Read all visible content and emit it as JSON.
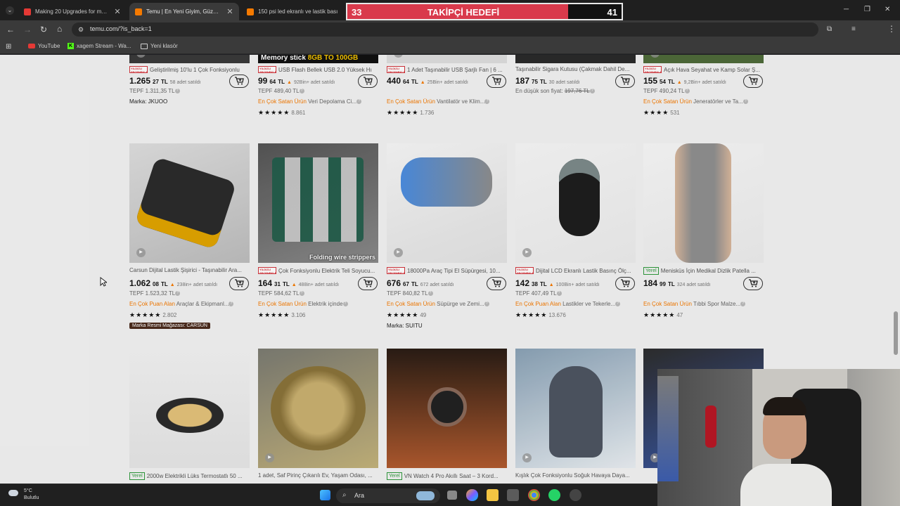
{
  "tabs": [
    {
      "title": "Making 20 Upgrades for my De",
      "favicon_color": "#e53935",
      "active": false
    },
    {
      "title": "Temu | En Yeni Giyim, Güzellik, E",
      "favicon_color": "#f57a00",
      "active": true
    },
    {
      "title": "150 psi led ekranlı ve lastik bası",
      "favicon_color": "#f57a00",
      "active": false
    }
  ],
  "address_bar": {
    "url": "temu.com/?is_back=1"
  },
  "bookmarks": [
    {
      "label": "YouTube",
      "icon": "youtube-icon"
    },
    {
      "label": "xagem Stream - Wa...",
      "icon": "kick-icon"
    },
    {
      "label": "Yeni klasör",
      "icon": "folder-icon"
    }
  ],
  "overlay": {
    "left": "33",
    "center": "TAKİPÇİ HEDEFİ",
    "right": "41",
    "progress": 0.805
  },
  "top_row": [
    {
      "badge": "yildizli",
      "title": "Geliştirilmiş 10'lu 1 Çok Fonksiyonlu",
      "price_main": "1.265",
      "price_dec": "27",
      "currency": "TL",
      "fire": false,
      "sold": "58 adet satıldı",
      "line2": "TEPF 1.311,35 TL",
      "line3_org": "",
      "line3_rest": "",
      "strike": "",
      "stars": "",
      "review_count": "",
      "brand": "Marka: JKUOO",
      "official": ""
    },
    {
      "badge": "yildizli",
      "title": "USB Flash Bellek USB 2.0 Yüksek Hı",
      "price_main": "99",
      "price_dec": "64",
      "currency": "TL",
      "fire": true,
      "sold": "92Bin+ adet satıldı",
      "line2": "TEPF 489,40 TL",
      "line3_org": "En Çok Satan Ürün",
      "line3_rest": " Veri Depolama Ci...",
      "strike": "",
      "stars": "★★★★★",
      "review_count": "8.861",
      "brand": "",
      "official": ""
    },
    {
      "badge": "yildizli",
      "title": "1 Adet Taşınabilir USB Şarjlı Fan | 6 ...",
      "price_main": "440",
      "price_dec": "64",
      "currency": "TL",
      "fire": true,
      "sold": "25Bin+ adet satıldı",
      "line2": "",
      "line3_org": "En Çok Satan Ürün",
      "line3_rest": " Vantilatör ve Klim...",
      "strike": "",
      "stars": "★★★★★",
      "review_count": "1.736",
      "brand": "",
      "official": ""
    },
    {
      "badge": "",
      "title": "Taşınabilir Sigara Kutusu (Çakmak Dahil De...",
      "price_main": "187",
      "price_dec": "75",
      "currency": "TL",
      "fire": false,
      "sold": "30 adet satıldı",
      "line2": "En düşük son fiyat: ",
      "strike": "197,76 TL",
      "line3_org": "",
      "line3_rest": "",
      "stars": "",
      "review_count": "",
      "brand": "",
      "official": ""
    },
    {
      "badge": "yildizli",
      "title": "Açık Hava Seyahat ve Kamp Solar Ş...",
      "price_main": "155",
      "price_dec": "54",
      "currency": "TL",
      "fire": true,
      "sold": "9,2Bin+ adet satıldı",
      "line2": "TEPF 490,24 TL",
      "line3_org": "En Çok Satan Ürün",
      "line3_rest": " Jeneratörler ve Ta...",
      "strike": "",
      "stars": "★★★★",
      "review_count": "531",
      "brand": "",
      "official": ""
    }
  ],
  "mid_row": [
    {
      "badge": "",
      "title": "Carsun Dijital Lastik Şişirici - Taşınabilir Ara...",
      "price_main": "1.062",
      "price_dec": "08",
      "currency": "TL",
      "fire": true,
      "sold": "238in+ adet satıldı",
      "line2": "TEPF 1.523,32 TL",
      "line3_org": "En Çok Puan Alan",
      "line3_rest": " Araçlar & Ekipmanl...",
      "stars": "★★★★★",
      "review_count": "2.802",
      "brand": "",
      "official": "Marka Resmi Mağazası: CARSUN",
      "img_text": ""
    },
    {
      "badge": "yildizli",
      "title": "Çok Fonksiyonlu Elektrik Teli Soyucu...",
      "price_main": "164",
      "price_dec": "31",
      "currency": "TL",
      "fire": true,
      "sold": "488in+ adet satıldı",
      "line2": "TEPF 584,62 TL",
      "line3_org": "En Çok Satan Ürün",
      "line3_rest": " Elektrik içinde",
      "stars": "★★★★★",
      "review_count": "3.106",
      "brand": "",
      "official": "",
      "img_text": "Folding wire strippers"
    },
    {
      "badge": "yildizli",
      "title": "18000Pa Araç Tipi El Süpürgesi, 10...",
      "price_main": "676",
      "price_dec": "67",
      "currency": "TL",
      "fire": false,
      "sold": "672 adet satıldı",
      "line2": "TEPF 840,82 TL",
      "line3_org": "En Çok Satan Ürün",
      "line3_rest": " Süpürge ve Zemi...",
      "stars": "★★★★★",
      "review_count": "49",
      "brand": "Marka: SUITU",
      "official": "",
      "img_text": ""
    },
    {
      "badge": "yildizli",
      "title": "Dijital LCD Ekranlı Lastik Basınç Ölç...",
      "price_main": "142",
      "price_dec": "38",
      "currency": "TL",
      "fire": true,
      "sold": "100Bin+ adet satıldı",
      "line2": "TEPF 407,49 TL",
      "line3_org": "En Çok Puan Alan",
      "line3_rest": " Lastikler ve Tekerle...",
      "stars": "★★★★★",
      "review_count": "13.676",
      "brand": "",
      "official": "",
      "img_text": ""
    },
    {
      "badge": "yerel",
      "title": "Menisküs İçin Medikal Dizlik Patella ...",
      "price_main": "184",
      "price_dec": "99",
      "currency": "TL",
      "fire": false,
      "sold": "324 adet satıldı",
      "line2": "",
      "line3_org": "En Çok Satan Ürün",
      "line3_rest": " Tıbbi Spor Malze...",
      "stars": "★★★★★",
      "review_count": "47",
      "brand": "",
      "official": "",
      "img_text": ""
    }
  ],
  "bottom_row": [
    {
      "badge": "yerel",
      "title": "2000w Elektrikli Lüks Termostatlı 50 ..."
    },
    {
      "badge": "",
      "title": "1 adet, Saf Pirinç Çıkarılı Ev, Yaşam Odası, ..."
    },
    {
      "badge": "yerel",
      "title": "VN Watch 4 Pro Akıllı Saat – 3 Kord..."
    },
    {
      "badge": "",
      "title": "Kışlık Çok Fonksiyonlu Soğuk Havaya Daya..."
    },
    {
      "badge": "",
      "title": ""
    }
  ],
  "labels": {
    "yildizli": "YILDIZLI SEÇENEKLER",
    "yerel": "Yerel",
    "memory_stick": "Memory stick ",
    "memory_size": "8GB TO 100GB"
  },
  "taskbar": {
    "temp": "5°C",
    "weather": "Bulutlu",
    "search": "Ara"
  },
  "colors": {
    "accent_orange": "#f57a00",
    "badge_red": "#d3343b",
    "local_green": "#2e9a3c",
    "overlay_red": "#d93a4c"
  }
}
